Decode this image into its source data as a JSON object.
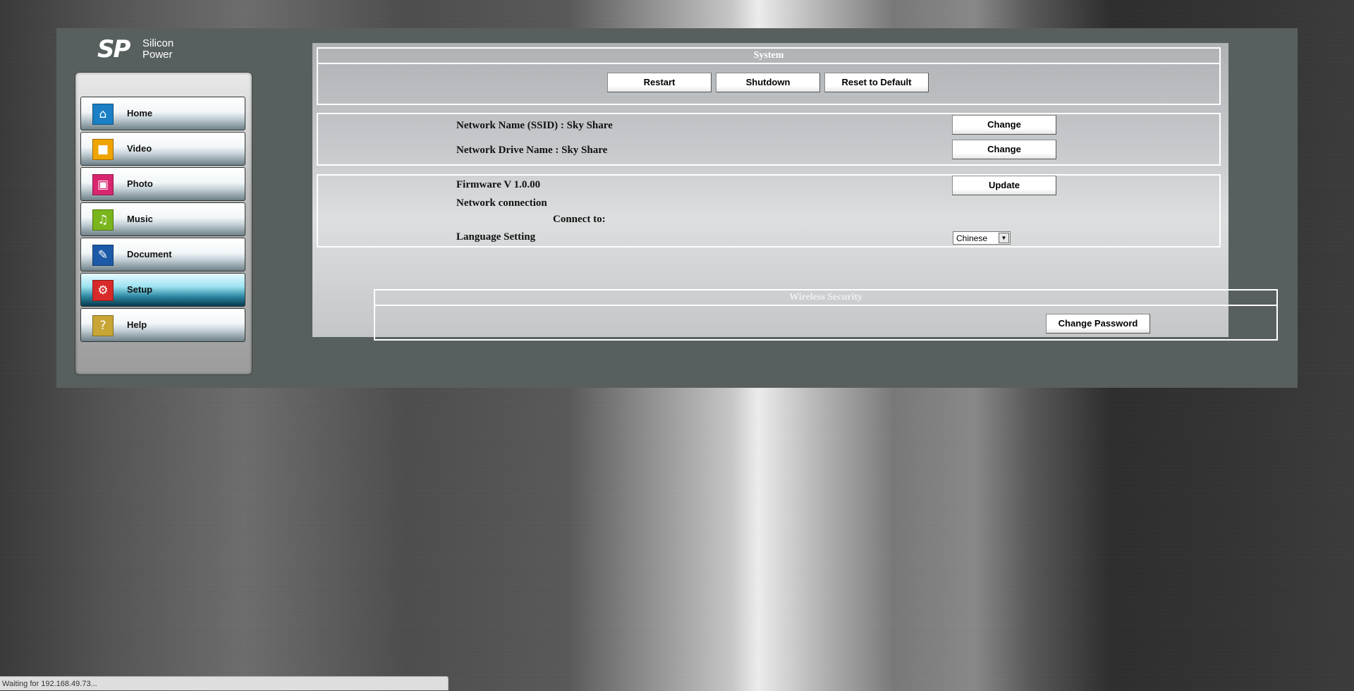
{
  "logo": {
    "mark": "SP",
    "brand_line1": "Silicon",
    "brand_line2": "Power"
  },
  "sidebar": {
    "items": [
      {
        "label": "Home",
        "icon": "home-icon",
        "color": "#1a7fc4"
      },
      {
        "label": "Video",
        "icon": "video-icon",
        "color": "#f0a400"
      },
      {
        "label": "Photo",
        "icon": "photo-icon",
        "color": "#d8266f"
      },
      {
        "label": "Music",
        "icon": "music-icon",
        "color": "#7ab51d"
      },
      {
        "label": "Document",
        "icon": "document-icon",
        "color": "#1c5aa8"
      },
      {
        "label": "Setup",
        "icon": "gear-icon",
        "color": "#d82a2a",
        "active": true
      },
      {
        "label": "Help",
        "icon": "help-icon",
        "color": "#c8a636"
      }
    ]
  },
  "system": {
    "title": "System",
    "restart": "Restart",
    "shutdown": "Shutdown",
    "reset": "Reset to Default"
  },
  "network": {
    "ssid_label": "Network Name (SSID) : Sky Share",
    "drive_label": "Network Drive Name : Sky Share",
    "change_ssid": "Change",
    "change_drive": "Change"
  },
  "firmware": {
    "version_label": "Firmware V 1.0.00",
    "update": "Update",
    "connection_label": "Network connection",
    "connect_to_label": "Connect to:",
    "language_label": "Language Setting",
    "language_value": "Chinese"
  },
  "security": {
    "title": "Wireless Security",
    "change_password": "Change Password"
  },
  "status": {
    "text": "Waiting for 192.168.49.73..."
  }
}
